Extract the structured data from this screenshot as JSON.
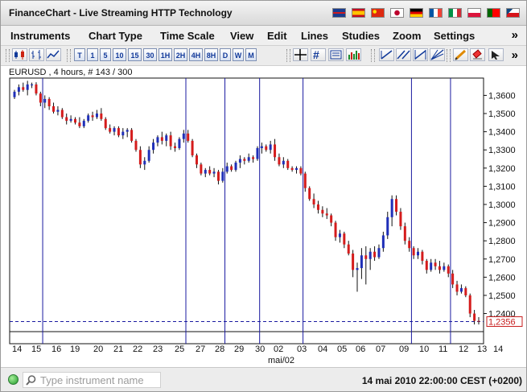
{
  "window": {
    "title": "FinanceChart - Live Streaming HTTP Technology",
    "language_flags": [
      {
        "name": "uk-flag-icon",
        "colors": [
          "#1a3c8e",
          "#d01c1f"
        ]
      },
      {
        "name": "spain-flag-icon",
        "colors": [
          "#c60b1e",
          "#ffc400"
        ]
      },
      {
        "name": "china-flag-icon",
        "colors": [
          "#de2910",
          "#ffde00"
        ]
      },
      {
        "name": "japan-flag-icon",
        "colors": [
          "#ffffff",
          "#bc002d"
        ]
      },
      {
        "name": "germany-flag-icon",
        "colors": [
          "#000000",
          "#dd0000",
          "#ffce00"
        ]
      },
      {
        "name": "france-flag-icon",
        "colors": [
          "#0055a4",
          "#ffffff",
          "#ef4135"
        ]
      },
      {
        "name": "italy-flag-icon",
        "colors": [
          "#009246",
          "#ffffff",
          "#ce2b37"
        ]
      },
      {
        "name": "poland-flag-icon",
        "colors": [
          "#ffffff",
          "#dc143c"
        ]
      },
      {
        "name": "portugal-flag-icon",
        "colors": [
          "#006600",
          "#ff0000"
        ]
      },
      {
        "name": "czech-flag-icon",
        "colors": [
          "#ffffff",
          "#d7141a",
          "#11457e"
        ]
      }
    ]
  },
  "menu": {
    "items": [
      "Instruments",
      "Chart Type",
      "Time Scale",
      "View",
      "Edit",
      "Lines",
      "Studies",
      "Zoom",
      "Settings"
    ],
    "more": "»"
  },
  "toolbar": {
    "chart_type_icons": [
      "candlestick-chart-icon",
      "bar-chart-icon",
      "line-chart-icon"
    ],
    "timeframes": [
      "T",
      "1",
      "5",
      "10",
      "15",
      "30",
      "1H",
      "2H",
      "4H",
      "8H",
      "D",
      "W",
      "M"
    ],
    "tool_icons": [
      "crosshair-icon",
      "grid-icon",
      "data-window-icon",
      "volume-icon",
      "draw-line-icon",
      "draw-channel-icon",
      "draw-fibonacci-icon",
      "draw-gann-icon",
      "edit-pencil-icon",
      "eraser-icon",
      "pointer-icon"
    ],
    "more": "»"
  },
  "chart_data": {
    "type": "candlestick",
    "title": "EURUSD , 4 hours, # 143 / 300",
    "ylim": [
      1.2305,
      1.3695
    ],
    "y_ticks": [
      "1,2400",
      "1,2500",
      "1,2600",
      "1,2700",
      "1,2800",
      "1,2900",
      "1,3000",
      "1,3100",
      "1,3200",
      "1,3300",
      "1,3400",
      "1,3500",
      "1,3600"
    ],
    "x_ticks": [
      "14",
      "15",
      "16",
      "19",
      "20",
      "21",
      "22",
      "23",
      "25",
      "27",
      "28",
      "29",
      "30",
      "02",
      "03",
      "04",
      "05",
      "06",
      "07",
      "09",
      "10",
      "11",
      "12",
      "13",
      "14"
    ],
    "x_sublabel": "mai/02",
    "last_price": "1,2356",
    "last_price_value": 1.2356,
    "up_color": "#1f2fb8",
    "down_color": "#d41c1c",
    "separator_color": "#1a1aa0",
    "candles": [
      {
        "o": 1.359,
        "h": 1.363,
        "l": 1.358,
        "c": 1.362
      },
      {
        "o": 1.362,
        "h": 1.366,
        "l": 1.36,
        "c": 1.3645
      },
      {
        "o": 1.3645,
        "h": 1.367,
        "l": 1.362,
        "c": 1.363
      },
      {
        "o": 1.363,
        "h": 1.368,
        "l": 1.36,
        "c": 1.366
      },
      {
        "o": 1.3655,
        "h": 1.367,
        "l": 1.364,
        "c": 1.366
      },
      {
        "o": 1.366,
        "h": 1.3672,
        "l": 1.36,
        "c": 1.361
      },
      {
        "o": 1.361,
        "h": 1.362,
        "l": 1.354,
        "c": 1.356
      },
      {
        "o": 1.356,
        "h": 1.36,
        "l": 1.353,
        "c": 1.358
      },
      {
        "o": 1.358,
        "h": 1.359,
        "l": 1.352,
        "c": 1.354
      },
      {
        "o": 1.354,
        "h": 1.356,
        "l": 1.35,
        "c": 1.351
      },
      {
        "o": 1.351,
        "h": 1.354,
        "l": 1.349,
        "c": 1.352
      },
      {
        "o": 1.352,
        "h": 1.353,
        "l": 1.347,
        "c": 1.348
      },
      {
        "o": 1.348,
        "h": 1.35,
        "l": 1.344,
        "c": 1.346
      },
      {
        "o": 1.346,
        "h": 1.349,
        "l": 1.345,
        "c": 1.347
      },
      {
        "o": 1.347,
        "h": 1.348,
        "l": 1.344,
        "c": 1.345
      },
      {
        "o": 1.345,
        "h": 1.348,
        "l": 1.342,
        "c": 1.343
      },
      {
        "o": 1.343,
        "h": 1.347,
        "l": 1.342,
        "c": 1.346
      },
      {
        "o": 1.346,
        "h": 1.35,
        "l": 1.345,
        "c": 1.349
      },
      {
        "o": 1.349,
        "h": 1.351,
        "l": 1.346,
        "c": 1.348
      },
      {
        "o": 1.348,
        "h": 1.352,
        "l": 1.347,
        "c": 1.35
      },
      {
        "o": 1.35,
        "h": 1.353,
        "l": 1.346,
        "c": 1.347
      },
      {
        "o": 1.347,
        "h": 1.348,
        "l": 1.341,
        "c": 1.342
      },
      {
        "o": 1.342,
        "h": 1.344,
        "l": 1.339,
        "c": 1.34
      },
      {
        "o": 1.34,
        "h": 1.343,
        "l": 1.338,
        "c": 1.342
      },
      {
        "o": 1.342,
        "h": 1.343,
        "l": 1.337,
        "c": 1.338
      },
      {
        "o": 1.338,
        "h": 1.342,
        "l": 1.336,
        "c": 1.34
      },
      {
        "o": 1.34,
        "h": 1.342,
        "l": 1.337,
        "c": 1.341
      },
      {
        "o": 1.341,
        "h": 1.342,
        "l": 1.334,
        "c": 1.335
      },
      {
        "o": 1.335,
        "h": 1.336,
        "l": 1.329,
        "c": 1.33
      },
      {
        "o": 1.33,
        "h": 1.332,
        "l": 1.32,
        "c": 1.322
      },
      {
        "o": 1.322,
        "h": 1.326,
        "l": 1.319,
        "c": 1.324
      },
      {
        "o": 1.324,
        "h": 1.332,
        "l": 1.323,
        "c": 1.33
      },
      {
        "o": 1.33,
        "h": 1.336,
        "l": 1.328,
        "c": 1.334
      },
      {
        "o": 1.334,
        "h": 1.338,
        "l": 1.332,
        "c": 1.337
      },
      {
        "o": 1.337,
        "h": 1.34,
        "l": 1.333,
        "c": 1.335
      },
      {
        "o": 1.335,
        "h": 1.339,
        "l": 1.332,
        "c": 1.338
      },
      {
        "o": 1.338,
        "h": 1.34,
        "l": 1.33,
        "c": 1.332
      },
      {
        "o": 1.332,
        "h": 1.334,
        "l": 1.329,
        "c": 1.331
      },
      {
        "o": 1.331,
        "h": 1.337,
        "l": 1.33,
        "c": 1.336
      },
      {
        "o": 1.336,
        "h": 1.341,
        "l": 1.334,
        "c": 1.339
      },
      {
        "o": 1.339,
        "h": 1.341,
        "l": 1.334,
        "c": 1.335
      },
      {
        "o": 1.335,
        "h": 1.336,
        "l": 1.326,
        "c": 1.327
      },
      {
        "o": 1.327,
        "h": 1.328,
        "l": 1.32,
        "c": 1.322
      },
      {
        "o": 1.322,
        "h": 1.323,
        "l": 1.316,
        "c": 1.317
      },
      {
        "o": 1.317,
        "h": 1.32,
        "l": 1.315,
        "c": 1.319
      },
      {
        "o": 1.319,
        "h": 1.321,
        "l": 1.316,
        "c": 1.317
      },
      {
        "o": 1.317,
        "h": 1.32,
        "l": 1.315,
        "c": 1.318
      },
      {
        "o": 1.318,
        "h": 1.319,
        "l": 1.311,
        "c": 1.313
      },
      {
        "o": 1.313,
        "h": 1.32,
        "l": 1.312,
        "c": 1.318
      },
      {
        "o": 1.318,
        "h": 1.323,
        "l": 1.317,
        "c": 1.321
      },
      {
        "o": 1.321,
        "h": 1.322,
        "l": 1.318,
        "c": 1.319
      },
      {
        "o": 1.319,
        "h": 1.324,
        "l": 1.318,
        "c": 1.323
      },
      {
        "o": 1.323,
        "h": 1.327,
        "l": 1.32,
        "c": 1.325
      },
      {
        "o": 1.325,
        "h": 1.326,
        "l": 1.322,
        "c": 1.324
      },
      {
        "o": 1.324,
        "h": 1.328,
        "l": 1.323,
        "c": 1.326
      },
      {
        "o": 1.326,
        "h": 1.327,
        "l": 1.323,
        "c": 1.325
      },
      {
        "o": 1.325,
        "h": 1.332,
        "l": 1.324,
        "c": 1.331
      },
      {
        "o": 1.331,
        "h": 1.334,
        "l": 1.328,
        "c": 1.332
      },
      {
        "o": 1.332,
        "h": 1.333,
        "l": 1.329,
        "c": 1.33
      },
      {
        "o": 1.33,
        "h": 1.335,
        "l": 1.328,
        "c": 1.333
      },
      {
        "o": 1.333,
        "h": 1.336,
        "l": 1.324,
        "c": 1.326
      },
      {
        "o": 1.326,
        "h": 1.328,
        "l": 1.321,
        "c": 1.322
      },
      {
        "o": 1.322,
        "h": 1.326,
        "l": 1.32,
        "c": 1.324
      },
      {
        "o": 1.324,
        "h": 1.325,
        "l": 1.319,
        "c": 1.32
      },
      {
        "o": 1.32,
        "h": 1.321,
        "l": 1.318,
        "c": 1.319
      },
      {
        "o": 1.319,
        "h": 1.321,
        "l": 1.317,
        "c": 1.32
      },
      {
        "o": 1.32,
        "h": 1.321,
        "l": 1.316,
        "c": 1.317
      },
      {
        "o": 1.317,
        "h": 1.318,
        "l": 1.307,
        "c": 1.309
      },
      {
        "o": 1.309,
        "h": 1.31,
        "l": 1.302,
        "c": 1.303
      },
      {
        "o": 1.303,
        "h": 1.306,
        "l": 1.298,
        "c": 1.3
      },
      {
        "o": 1.3,
        "h": 1.302,
        "l": 1.295,
        "c": 1.297
      },
      {
        "o": 1.297,
        "h": 1.299,
        "l": 1.293,
        "c": 1.295
      },
      {
        "o": 1.295,
        "h": 1.298,
        "l": 1.292,
        "c": 1.294
      },
      {
        "o": 1.294,
        "h": 1.295,
        "l": 1.288,
        "c": 1.29
      },
      {
        "o": 1.29,
        "h": 1.291,
        "l": 1.28,
        "c": 1.282
      },
      {
        "o": 1.282,
        "h": 1.286,
        "l": 1.279,
        "c": 1.284
      },
      {
        "o": 1.284,
        "h": 1.285,
        "l": 1.276,
        "c": 1.278
      },
      {
        "o": 1.278,
        "h": 1.28,
        "l": 1.272,
        "c": 1.273
      },
      {
        "o": 1.273,
        "h": 1.275,
        "l": 1.26,
        "c": 1.264
      },
      {
        "o": 1.264,
        "h": 1.268,
        "l": 1.252,
        "c": 1.265
      },
      {
        "o": 1.265,
        "h": 1.276,
        "l": 1.259,
        "c": 1.272
      },
      {
        "o": 1.272,
        "h": 1.277,
        "l": 1.256,
        "c": 1.27
      },
      {
        "o": 1.27,
        "h": 1.276,
        "l": 1.264,
        "c": 1.274
      },
      {
        "o": 1.274,
        "h": 1.277,
        "l": 1.269,
        "c": 1.271
      },
      {
        "o": 1.271,
        "h": 1.278,
        "l": 1.27,
        "c": 1.276
      },
      {
        "o": 1.276,
        "h": 1.285,
        "l": 1.274,
        "c": 1.283
      },
      {
        "o": 1.283,
        "h": 1.296,
        "l": 1.281,
        "c": 1.293
      },
      {
        "o": 1.293,
        "h": 1.305,
        "l": 1.288,
        "c": 1.303
      },
      {
        "o": 1.303,
        "h": 1.305,
        "l": 1.294,
        "c": 1.296
      },
      {
        "o": 1.296,
        "h": 1.298,
        "l": 1.286,
        "c": 1.288
      },
      {
        "o": 1.288,
        "h": 1.29,
        "l": 1.278,
        "c": 1.28
      },
      {
        "o": 1.28,
        "h": 1.282,
        "l": 1.274,
        "c": 1.276
      },
      {
        "o": 1.276,
        "h": 1.277,
        "l": 1.27,
        "c": 1.272
      },
      {
        "o": 1.272,
        "h": 1.276,
        "l": 1.27,
        "c": 1.274
      },
      {
        "o": 1.274,
        "h": 1.275,
        "l": 1.267,
        "c": 1.269
      },
      {
        "o": 1.269,
        "h": 1.27,
        "l": 1.262,
        "c": 1.264
      },
      {
        "o": 1.264,
        "h": 1.27,
        "l": 1.263,
        "c": 1.268
      },
      {
        "o": 1.268,
        "h": 1.27,
        "l": 1.264,
        "c": 1.266
      },
      {
        "o": 1.266,
        "h": 1.269,
        "l": 1.262,
        "c": 1.264
      },
      {
        "o": 1.264,
        "h": 1.268,
        "l": 1.263,
        "c": 1.266
      },
      {
        "o": 1.266,
        "h": 1.267,
        "l": 1.26,
        "c": 1.262
      },
      {
        "o": 1.262,
        "h": 1.264,
        "l": 1.254,
        "c": 1.256
      },
      {
        "o": 1.256,
        "h": 1.258,
        "l": 1.25,
        "c": 1.252
      },
      {
        "o": 1.252,
        "h": 1.256,
        "l": 1.251,
        "c": 1.254
      },
      {
        "o": 1.254,
        "h": 1.255,
        "l": 1.249,
        "c": 1.25
      },
      {
        "o": 1.25,
        "h": 1.251,
        "l": 1.238,
        "c": 1.24
      },
      {
        "o": 1.24,
        "h": 1.242,
        "l": 1.234,
        "c": 1.236
      },
      {
        "o": 1.236,
        "h": 1.238,
        "l": 1.234,
        "c": 1.2356
      }
    ],
    "separators_after_candle": [
      6,
      39,
      48,
      56,
      66,
      91,
      100
    ]
  },
  "status": {
    "search_placeholder": "Type instrument name",
    "datetime": "14 mai 2010 22:00:00  CEST (+0200)"
  }
}
